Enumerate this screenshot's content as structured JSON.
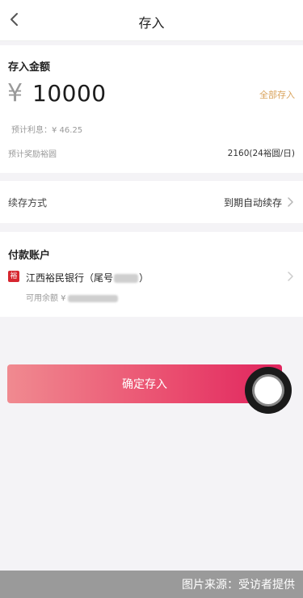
{
  "header": {
    "title": "存入",
    "back_icon": "chevron-left-icon"
  },
  "deposit": {
    "section_title": "存入金额",
    "currency_symbol": "¥",
    "amount": "10000",
    "deposit_all_label": "全部存入",
    "estimated_interest": "预计利息：¥ 46.25",
    "reward_label": "预计奖励裕圆",
    "reward_value": "2160(24裕圆/日)"
  },
  "renewal": {
    "label": "续存方式",
    "value": "到期自动续存"
  },
  "payment": {
    "section_title": "付款账户",
    "bank_name": "江西裕民银行（尾号",
    "bank_name_close": "）",
    "balance_label": "可用余额 ¥",
    "bank_logo_char": "裕"
  },
  "confirm_button": {
    "label": "确定存入"
  },
  "watermark": {
    "text": "图片来源：受访者提供"
  },
  "colors": {
    "accent_gold": "#d9a25a",
    "button_gradient_start": "#f08a90",
    "button_gradient_end": "#e0245e",
    "bank_red": "#d6262f"
  }
}
